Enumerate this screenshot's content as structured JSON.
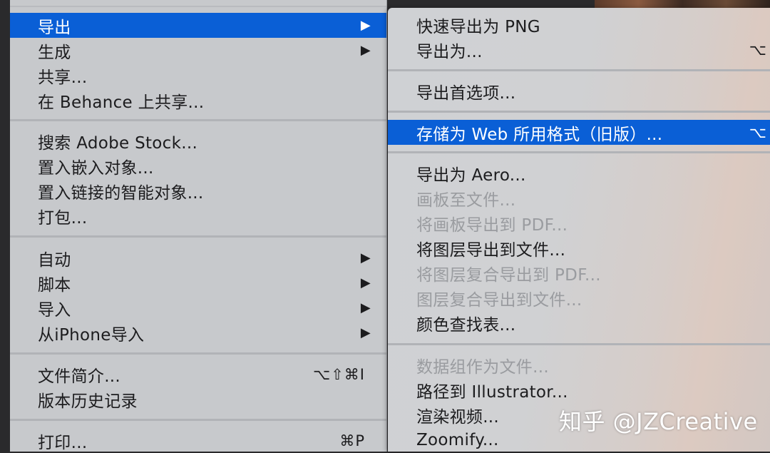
{
  "main_menu": {
    "items": [
      {
        "label": "导出",
        "arrow": "▶"
      },
      {
        "label": "生成",
        "arrow": "▶"
      },
      {
        "label": "共享..."
      },
      {
        "label": "在 Behance 上共享..."
      },
      {
        "label": "搜索 Adobe Stock..."
      },
      {
        "label": "置入嵌入对象..."
      },
      {
        "label": "置入链接的智能对象..."
      },
      {
        "label": "打包..."
      },
      {
        "label": "自动",
        "arrow": "▶"
      },
      {
        "label": "脚本",
        "arrow": "▶"
      },
      {
        "label": "导入",
        "arrow": "▶"
      },
      {
        "label": "从iPhone导入",
        "arrow": "▶"
      },
      {
        "label": "文件简介...",
        "shortcut": "⌥⇧⌘I"
      },
      {
        "label": "版本历史记录"
      },
      {
        "label": "打印...",
        "shortcut": "⌘P"
      }
    ]
  },
  "export_submenu": {
    "items": [
      {
        "label": "快速导出为 PNG"
      },
      {
        "label": "导出为...",
        "shortcut": "⌥"
      },
      {
        "label": "导出首选项..."
      },
      {
        "label": "存储为 Web 所用格式（旧版）...",
        "shortcut": "⌥"
      },
      {
        "label": "导出为 Aero..."
      },
      {
        "label": "画板至文件..."
      },
      {
        "label": "将画板导出到 PDF..."
      },
      {
        "label": "将图层导出到文件..."
      },
      {
        "label": "将图层复合导出到 PDF..."
      },
      {
        "label": "图层复合导出到文件..."
      },
      {
        "label": "颜色查找表..."
      },
      {
        "label": "数据组作为文件..."
      },
      {
        "label": "路径到 Illustrator..."
      },
      {
        "label": "渲染视频..."
      },
      {
        "label": "Zoomify..."
      }
    ]
  },
  "watermark": "知乎 @JZCreative",
  "colors": {
    "highlight": "#0a5fd6",
    "menu_bg": "#c7c9cc",
    "disabled_text": "#9a9ca0"
  }
}
